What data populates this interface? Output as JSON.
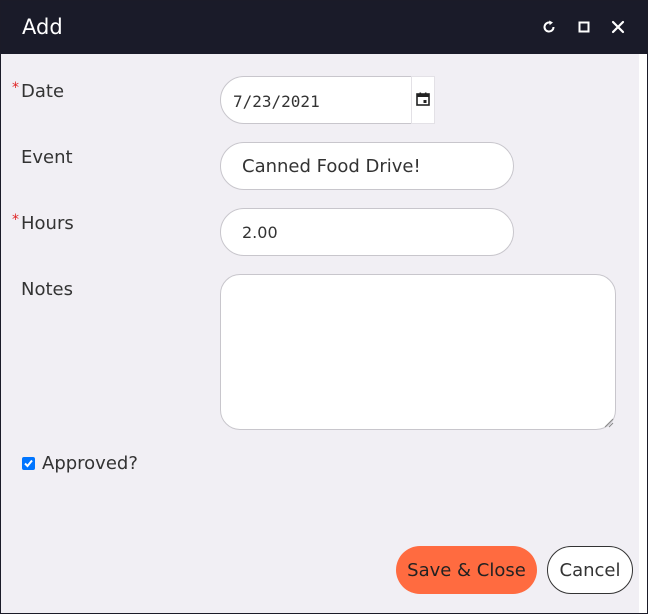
{
  "dialog": {
    "title": "Add",
    "controls": {
      "refresh_icon": "refresh-icon",
      "maximize_icon": "maximize-icon",
      "close_icon": "close-icon"
    }
  },
  "form": {
    "required_marker": "*",
    "date": {
      "label": "Date",
      "value": "7/23/2021",
      "required": true,
      "picker_icon": "calendar-icon"
    },
    "event": {
      "label": "Event",
      "value": "Canned Food Drive!"
    },
    "hours": {
      "label": "Hours",
      "value": "2.00",
      "required": true
    },
    "notes": {
      "label": "Notes",
      "value": ""
    },
    "approved": {
      "label": "Approved?",
      "checked": true
    }
  },
  "actions": {
    "save_close": "Save & Close",
    "cancel": "Cancel"
  },
  "colors": {
    "titlebar": "#1a1b29",
    "background": "#f1eff4",
    "primary_button": "#ff6b40",
    "required": "#e02424",
    "checkbox": "#0075ff"
  }
}
